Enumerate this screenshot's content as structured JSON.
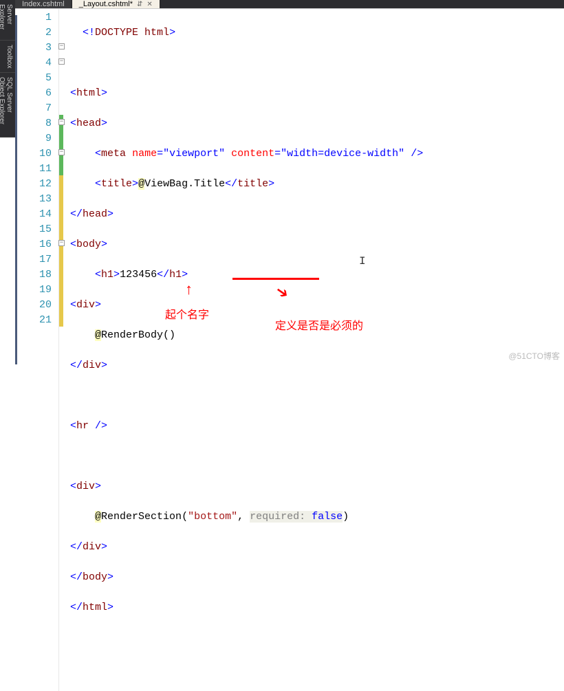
{
  "sidebar": {
    "items": [
      {
        "label": "Server Explorer"
      },
      {
        "label": "Toolbox"
      },
      {
        "label": "SQL Server Object Explorer"
      }
    ]
  },
  "tabs": [
    {
      "label": "Index.cshtml",
      "active": false
    },
    {
      "label": "_Layout.cshtml*",
      "active": true
    }
  ],
  "icons": {
    "pin": "⇵",
    "close": "✕",
    "outline_minus": "−"
  },
  "code": {
    "lines": [
      {
        "n": 1,
        "change": "",
        "outline": false
      },
      {
        "n": 2,
        "change": "",
        "outline": false
      },
      {
        "n": 3,
        "change": "",
        "outline": true
      },
      {
        "n": 4,
        "change": "",
        "outline": true
      },
      {
        "n": 5,
        "change": "",
        "outline": false
      },
      {
        "n": 6,
        "change": "",
        "outline": false
      },
      {
        "n": 7,
        "change": "",
        "outline": false
      },
      {
        "n": 8,
        "change": "green",
        "outline": true
      },
      {
        "n": 9,
        "change": "green",
        "outline": false
      },
      {
        "n": 10,
        "change": "green",
        "outline": true
      },
      {
        "n": 11,
        "change": "green",
        "outline": false
      },
      {
        "n": 12,
        "change": "yellow",
        "outline": false
      },
      {
        "n": 13,
        "change": "yellow",
        "outline": false
      },
      {
        "n": 14,
        "change": "yellow",
        "outline": false
      },
      {
        "n": 15,
        "change": "yellow",
        "outline": false
      },
      {
        "n": 16,
        "change": "yellow",
        "outline": true
      },
      {
        "n": 17,
        "change": "yellow",
        "outline": false
      },
      {
        "n": 18,
        "change": "yellow",
        "outline": false
      },
      {
        "n": 19,
        "change": "yellow",
        "outline": false
      },
      {
        "n": 20,
        "change": "yellow",
        "outline": false
      },
      {
        "n": 21,
        "change": "yellow",
        "outline": false
      }
    ],
    "content": {
      "l1_doctype_open": "<!",
      "l1_doctype": "DOCTYPE",
      "l1_html": " html",
      "l1_close": ">",
      "l3_open": "<",
      "l3_tag": "html",
      "l3_close": ">",
      "l4_open": "<",
      "l4_tag": "head",
      "l4_close": ">",
      "l5_open": "<",
      "l5_tag": "meta",
      "l5_attr1": "name",
      "l5_eq": "=",
      "l5_val1": "\"viewport\"",
      "l5_attr2": "content",
      "l5_val2": "\"width=device-width\"",
      "l5_selfclose": " />",
      "l6_open": "<",
      "l6_tag": "title",
      "l6_close": ">",
      "l6_at": "@",
      "l6_razor": "ViewBag.Title",
      "l6_close2_open": "</",
      "l6_tag2": "title",
      "l6_close2": ">",
      "l7_open": "</",
      "l7_tag": "head",
      "l7_close": ">",
      "l8_open": "<",
      "l8_tag": "body",
      "l8_close": ">",
      "l9_open": "<",
      "l9_tag": "h1",
      "l9_close": ">",
      "l9_text": "123456",
      "l9_close2_open": "</",
      "l9_tag2": "h1",
      "l9_close2": ">",
      "l10_open": "<",
      "l10_tag": "div",
      "l10_close": ">",
      "l11_at": "@",
      "l11_razor": "RenderBody()",
      "l12_open": "</",
      "l12_tag": "div",
      "l12_close": ">",
      "l14_open": "<",
      "l14_tag": "hr",
      "l14_selfclose": " />",
      "l16_open": "<",
      "l16_tag": "div",
      "l16_close": ">",
      "l17_at": "@",
      "l17_razor": "RenderSection",
      "l17_paren_open": "(",
      "l17_str": "\"bottom\"",
      "l17_comma": ", ",
      "l17_param": "required:",
      "l17_sp": " ",
      "l17_kw": "false",
      "l17_paren_close": ")",
      "l18_open": "</",
      "l18_tag": "div",
      "l18_close": ">",
      "l19_open": "</",
      "l19_tag": "body",
      "l19_close": ">",
      "l20_open": "</",
      "l20_tag": "html",
      "l20_close": ">"
    }
  },
  "annotations": {
    "name_label": "起个名字",
    "required_label": "定义是否是必须的"
  },
  "watermark": "@51CTO博客"
}
